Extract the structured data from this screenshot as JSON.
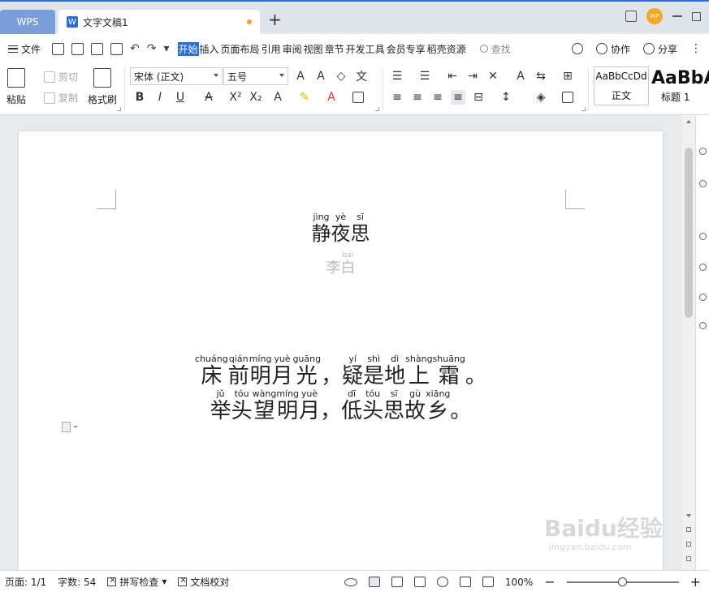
{
  "tabbar": {
    "wps_label": "WPS",
    "doc_title": "文字文稿1",
    "doc_icon": "W",
    "add_tab": "+",
    "avatar": "WP"
  },
  "menubar": {
    "file_label": "文件",
    "tabs": [
      "开始",
      "插入",
      "页面布局",
      "引用",
      "审阅",
      "视图",
      "章节",
      "开发工具",
      "会员专享",
      "稻壳资源"
    ],
    "active_tab": "开始",
    "search_label": "查找",
    "collab_label": "协作",
    "share_label": "分享",
    "more": "⋮"
  },
  "ribbon": {
    "paste": "粘贴",
    "cut": "剪切",
    "copy": "复制",
    "format_painter": "格式刷",
    "font_name": "宋体 (正文)",
    "font_size": "五号",
    "style_normal_sample": "AaBbCcDd",
    "style_normal_name": "正文",
    "style_h1_sample": "AaBbA",
    "style_h1_name": "标题 1"
  },
  "document": {
    "title": [
      {
        "char": "静",
        "py": "jìng"
      },
      {
        "char": "夜",
        "py": "yè"
      },
      {
        "char": "思",
        "py": "sī"
      }
    ],
    "author": [
      {
        "char": "李",
        "py": ""
      },
      {
        "char": "白",
        "py": "bái"
      }
    ],
    "line1": [
      {
        "char": "床",
        "py": "chuáng"
      },
      {
        "char": "前",
        "py": "qián"
      },
      {
        "char": "明",
        "py": "míng"
      },
      {
        "char": "月",
        "py": "yuè"
      },
      {
        "char": "光",
        "py": "guāng"
      },
      {
        "char": "，",
        "py": ""
      },
      {
        "char": "疑",
        "py": "yí"
      },
      {
        "char": "是",
        "py": "shì"
      },
      {
        "char": "地",
        "py": "dì"
      },
      {
        "char": "上",
        "py": "shàng"
      },
      {
        "char": "霜",
        "py": "shuāng"
      },
      {
        "char": "。",
        "py": ""
      }
    ],
    "line2": [
      {
        "char": "举",
        "py": "jǔ"
      },
      {
        "char": "头",
        "py": "tóu"
      },
      {
        "char": "望",
        "py": "wàng"
      },
      {
        "char": "明",
        "py": "míng"
      },
      {
        "char": "月",
        "py": "yuè"
      },
      {
        "char": "，",
        "py": ""
      },
      {
        "char": "低",
        "py": "dī"
      },
      {
        "char": "头",
        "py": "tóu"
      },
      {
        "char": "思",
        "py": "sī"
      },
      {
        "char": "故",
        "py": "gù"
      },
      {
        "char": "乡",
        "py": "xiāng"
      },
      {
        "char": "。",
        "py": ""
      }
    ]
  },
  "statusbar": {
    "page": "页面: 1/1",
    "words": "字数: 54",
    "spellcheck": "拼写检查",
    "proofread": "文档校对",
    "zoom": "100%",
    "zoom_minus": "−",
    "zoom_plus": "+",
    "zoom_fraction": 0.5
  },
  "watermark": {
    "text": "Baidu经验",
    "sub": "jingyan.baidu.com"
  },
  "colors": {
    "accent": "#2b6fd6",
    "wps_tab": "#7a9fd8",
    "avatar": "#f5a623"
  }
}
